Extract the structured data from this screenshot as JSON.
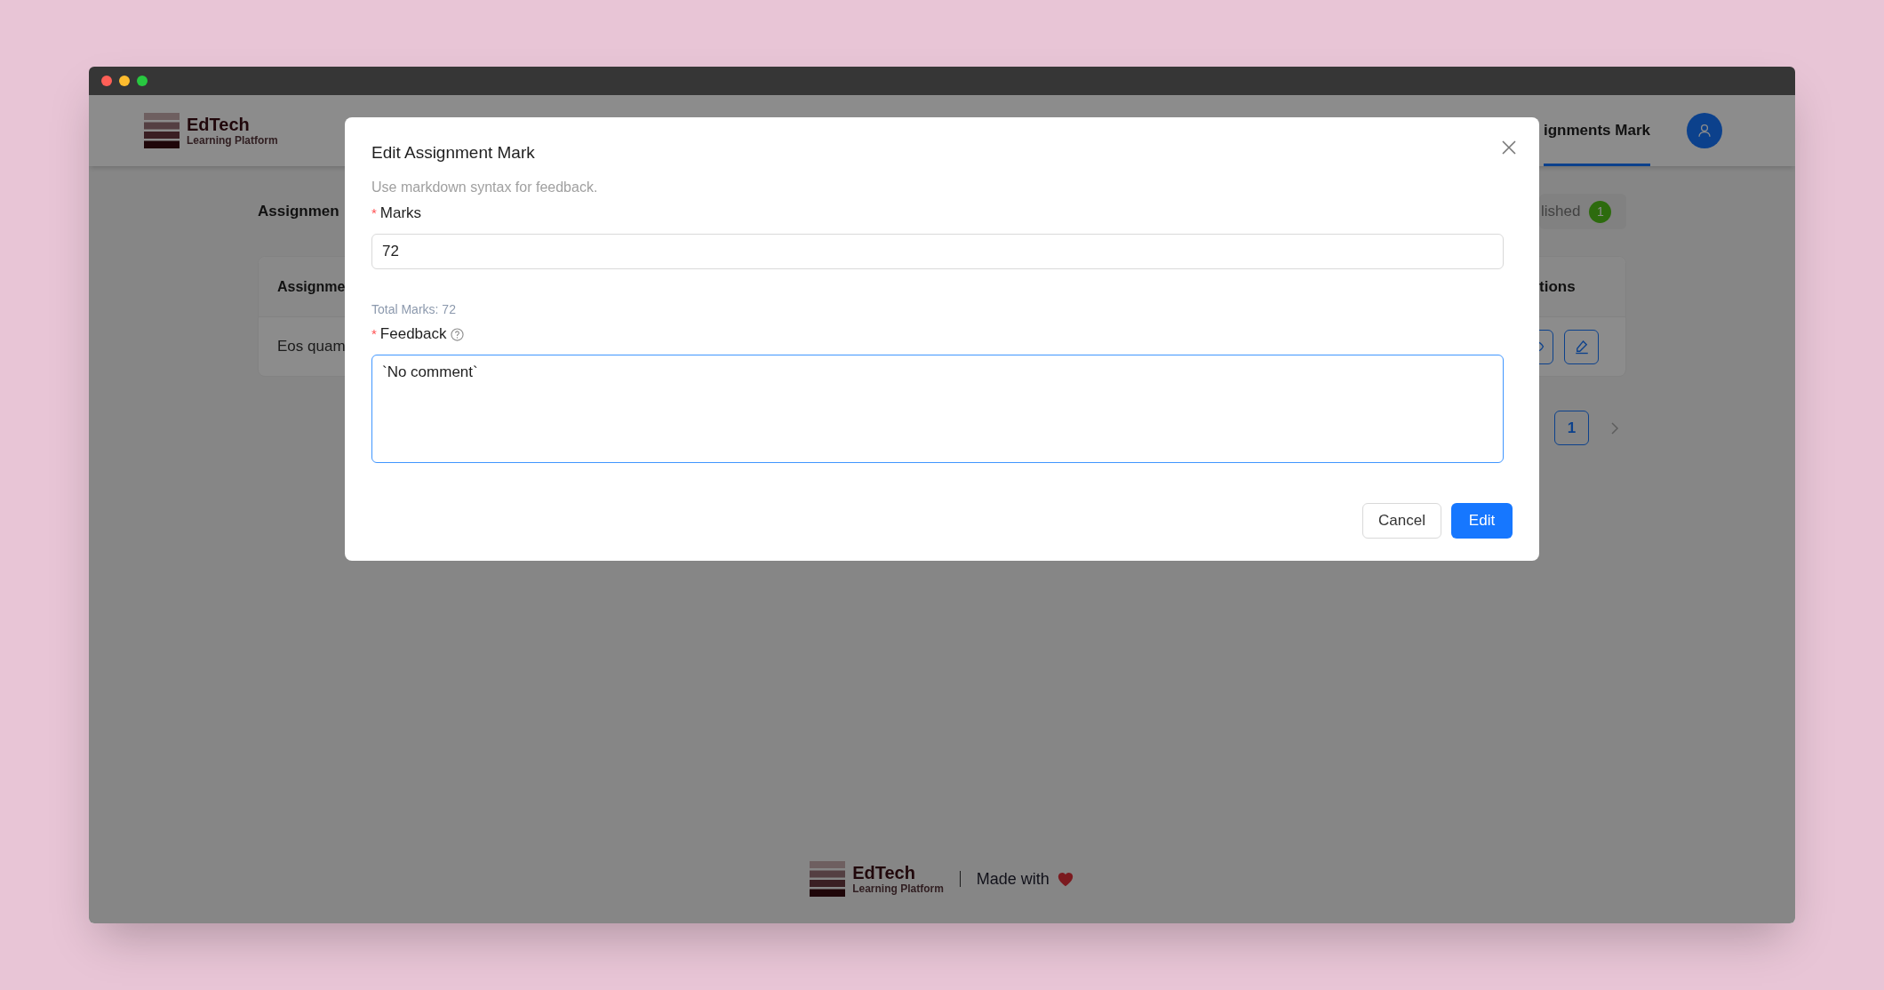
{
  "window": {
    "controls": [
      {
        "color": "#ff5f57"
      },
      {
        "color": "#febc2e"
      },
      {
        "color": "#28c840"
      }
    ]
  },
  "header": {
    "logo": {
      "title": "EdTech",
      "subtitle": "Learning Platform"
    },
    "nav": [
      {
        "label": "ignments Mark",
        "selected": true
      }
    ]
  },
  "page": {
    "heading": "Assignmen",
    "tabs": [
      {
        "label": "lished",
        "badge": "1",
        "selected": false
      }
    ],
    "table": {
      "columns": [
        "Assignme",
        "tions"
      ],
      "rows": [
        {
          "cells": [
            "Eos quam"
          ],
          "actions": [
            {
              "kind": "view"
            },
            {
              "kind": "edit"
            }
          ]
        }
      ]
    },
    "pagination": {
      "pages": [
        {
          "label": "1",
          "selected": true
        }
      ]
    }
  },
  "modal": {
    "title": "Edit Assignment Mark",
    "description": "Use markdown syntax for feedback.",
    "fields": [
      {
        "kind": "input",
        "label": "Marks",
        "required_mark": "*",
        "value": "72",
        "focused": false,
        "note": "Total Marks: 72"
      },
      {
        "kind": "textarea",
        "label": "Feedback",
        "required_mark": "*",
        "help": true,
        "value": "`No comment`",
        "focused": true
      }
    ],
    "buttons": [
      {
        "label": "Cancel",
        "kind": "default"
      },
      {
        "label": "Edit",
        "kind": "primary"
      }
    ]
  },
  "footer": {
    "logo": {
      "title": "EdTech",
      "subtitle": "Learning Platform"
    },
    "text": "Made with"
  }
}
